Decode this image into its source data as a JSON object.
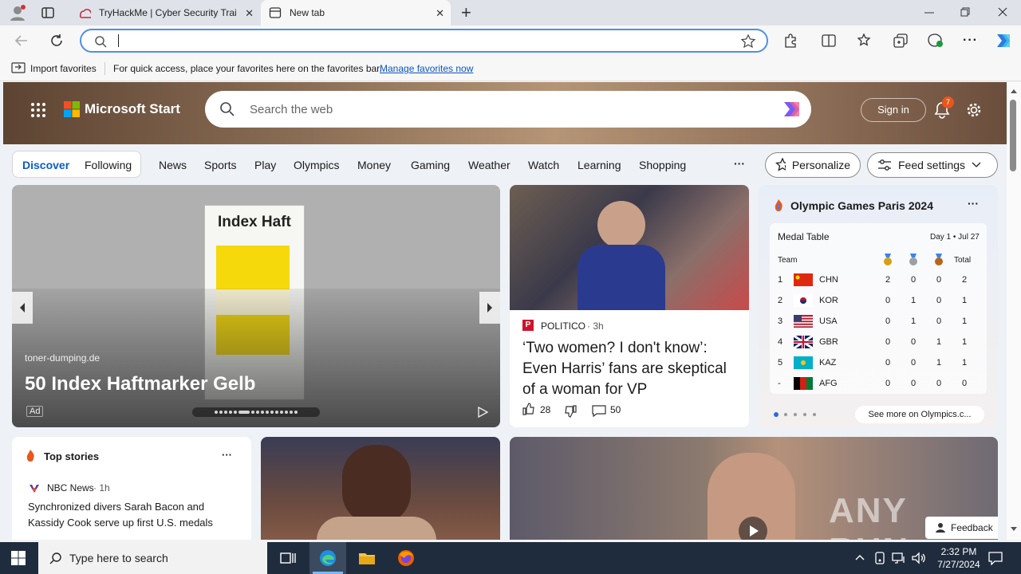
{
  "tabs": [
    {
      "label": "TryHackMe | Cyber Security Trai",
      "close": "✕"
    },
    {
      "label": "New tab",
      "close": "✕"
    }
  ],
  "window": {
    "new_tab": "+"
  },
  "favorites": {
    "import": "Import favorites",
    "hint": "For quick access, place your favorites here on the favorites bar.",
    "manage": "Manage favorites now"
  },
  "msstart": {
    "brand": "Microsoft Start",
    "search_placeholder": "Search the web",
    "signin": "Sign in",
    "notif_count": "7"
  },
  "nav": {
    "discover": "Discover",
    "following": "Following",
    "items": [
      "News",
      "Sports",
      "Play",
      "Olympics",
      "Money",
      "Gaming",
      "Weather",
      "Watch",
      "Learning",
      "Shopping"
    ],
    "more": "···",
    "personalize": "Personalize",
    "feed": "Feed settings"
  },
  "ad": {
    "source": "toner-dumping.de",
    "title": "50 Index Haftmarker Gelb",
    "badge": "Ad",
    "product_text": "Index Haft"
  },
  "news1": {
    "source": "POLITICO",
    "time": "· 3h",
    "title": "‘Two women? I don't know’: Even Harris’ fans are skeptical of a woman for VP",
    "likes": "28",
    "comments": "50"
  },
  "olympics": {
    "title": "Olympic Games Paris 2024",
    "menu": "···",
    "table_title": "Medal Table",
    "day": "Day 1 • Jul 27",
    "team_hdr": "Team",
    "total_hdr": "Total",
    "rows": [
      {
        "rank": "1",
        "code": "CHN",
        "g": "2",
        "s": "0",
        "b": "0",
        "t": "2"
      },
      {
        "rank": "2",
        "code": "KOR",
        "g": "0",
        "s": "1",
        "b": "0",
        "t": "1"
      },
      {
        "rank": "3",
        "code": "USA",
        "g": "0",
        "s": "1",
        "b": "0",
        "t": "1"
      },
      {
        "rank": "4",
        "code": "GBR",
        "g": "0",
        "s": "0",
        "b": "1",
        "t": "1"
      },
      {
        "rank": "5",
        "code": "KAZ",
        "g": "0",
        "s": "0",
        "b": "1",
        "t": "1"
      },
      {
        "rank": "-",
        "code": "AFG",
        "g": "0",
        "s": "0",
        "b": "0",
        "t": "0"
      }
    ],
    "see_more": "See more on Olympics.c..."
  },
  "top": {
    "title": "Top stories",
    "menu": "···",
    "source": "NBC News",
    "time": "· 1h",
    "headline": "Synchronized divers Sarah Bacon and Kassidy Cook serve up first U.S. medals"
  },
  "watermark": "ANY RUN",
  "feedback": "Feedback",
  "taskbar": {
    "search": "Type here to search",
    "time": "2:32 PM",
    "date": "7/27/2024"
  }
}
